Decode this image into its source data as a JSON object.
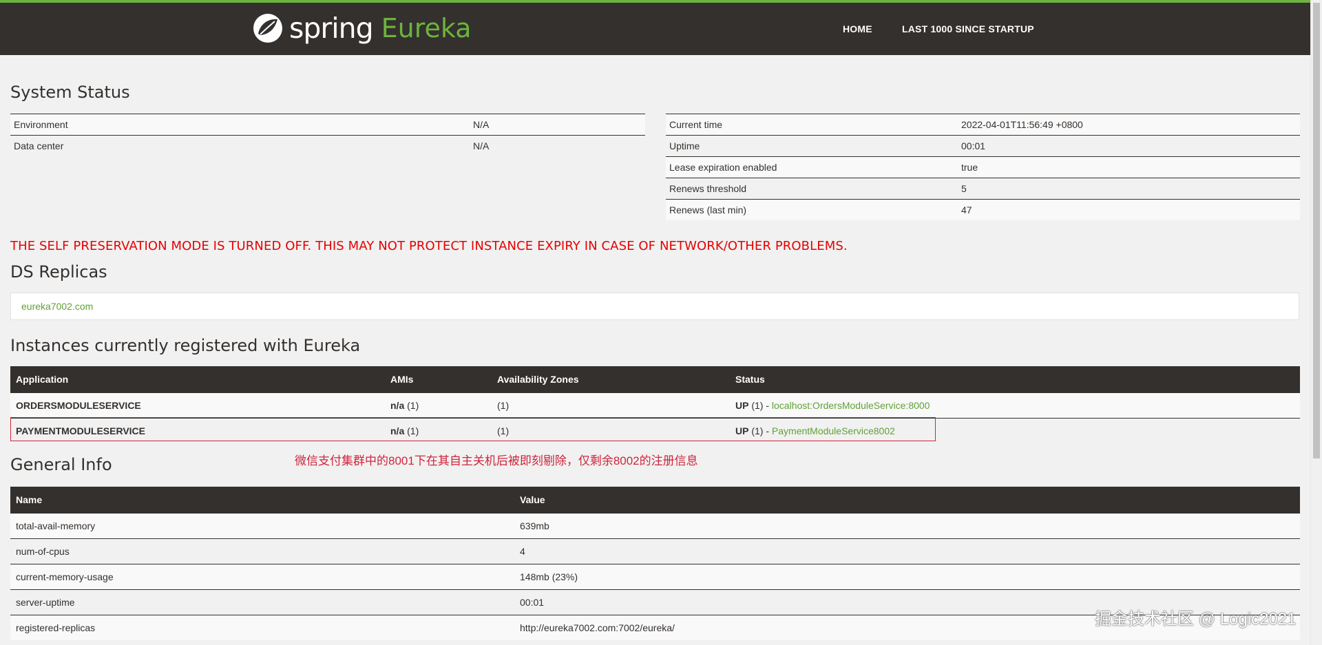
{
  "header": {
    "logo_word1": "spring",
    "logo_word2": "Eureka",
    "nav": [
      "HOME",
      "LAST 1000 SINCE STARTUP"
    ]
  },
  "system_status": {
    "title": "System Status",
    "left": [
      {
        "key": "Environment",
        "value": "N/A"
      },
      {
        "key": "Data center",
        "value": "N/A"
      }
    ],
    "right": [
      {
        "key": "Current time",
        "value": "2022-04-01T11:56:49 +0800"
      },
      {
        "key": "Uptime",
        "value": "00:01"
      },
      {
        "key": "Lease expiration enabled",
        "value": "true"
      },
      {
        "key": "Renews threshold",
        "value": "5"
      },
      {
        "key": "Renews (last min)",
        "value": "47"
      }
    ]
  },
  "warning": "THE SELF PRESERVATION MODE IS TURNED OFF. THIS MAY NOT PROTECT INSTANCE EXPIRY IN CASE OF NETWORK/OTHER PROBLEMS.",
  "ds_replicas": {
    "title": "DS Replicas",
    "items": [
      "eureka7002.com"
    ]
  },
  "instances": {
    "title": "Instances currently registered with Eureka",
    "columns": [
      "Application",
      "AMIs",
      "Availability Zones",
      "Status"
    ],
    "rows": [
      {
        "application": "ORDERSMODULESERVICE",
        "amis_bold": "n/a",
        "amis_count": " (1)",
        "zones": "(1)",
        "status_bold": "UP",
        "status_count": " (1) - ",
        "link": "localhost:OrdersModuleService:8000"
      },
      {
        "application": "PAYMENTMODULESERVICE",
        "amis_bold": "n/a",
        "amis_count": " (1)",
        "zones": "(1)",
        "status_bold": "UP",
        "status_count": " (1) - ",
        "link": "PaymentModuleService8002"
      }
    ]
  },
  "annotation": "微信支付集群中的8001下在其自主关机后被即刻剔除，仅剩余8002的注册信息",
  "general_info": {
    "title": "General Info",
    "columns": [
      "Name",
      "Value"
    ],
    "rows": [
      {
        "name": "total-avail-memory",
        "value": "639mb"
      },
      {
        "name": "num-of-cpus",
        "value": "4"
      },
      {
        "name": "current-memory-usage",
        "value": "148mb (23%)"
      },
      {
        "name": "server-uptime",
        "value": "00:01"
      },
      {
        "name": "registered-replicas",
        "value": "http://eureka7002.com:7002/eureka/"
      }
    ]
  },
  "watermark": "掘金技术社区 @ Logic2021",
  "colors": {
    "brand_green": "#6db33f",
    "dark": "#34302d",
    "warning_red": "#e80000",
    "annotation_red": "#d0243a"
  }
}
